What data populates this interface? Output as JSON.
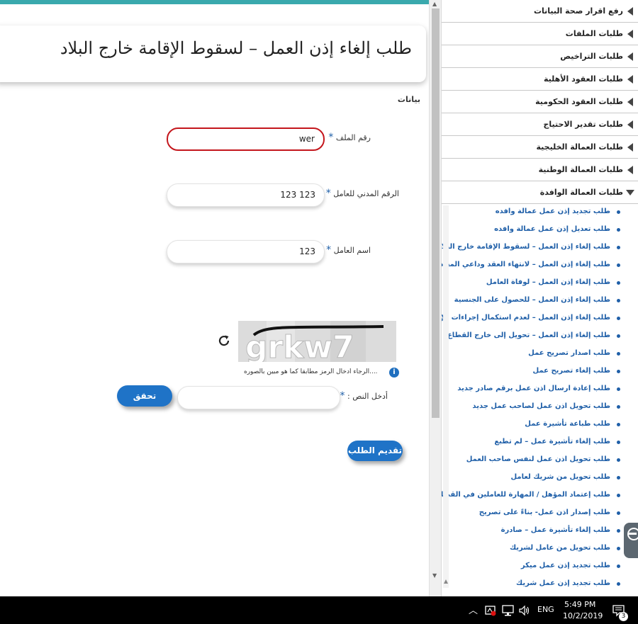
{
  "form": {
    "title": "طلب إلغاء إذن العمل – لسقوط الإقامة خارج البلاد",
    "section_label": "بيانات",
    "required_mark": "*",
    "file_number": {
      "label": "رقم الملف",
      "value": "wer"
    },
    "civil_id": {
      "label": "الرقم المدني للعامل",
      "value": "123 123"
    },
    "worker_name": {
      "label": "اسم العامل",
      "value": "123"
    },
    "captcha": {
      "image_text": "grkw7",
      "hint": "....الرجاء ادخال الرمز مطابقا كما هو مبين بالصوره",
      "info_icon": "i",
      "input_label": "أدخل النص :",
      "input_value": "",
      "verify_button": "تحقق"
    },
    "submit_button": "تقديم الطلب"
  },
  "sidebar": {
    "categories": [
      {
        "label": "رفع اقرار صحة البيانات",
        "expanded": false
      },
      {
        "label": "طلبات الملفات",
        "expanded": false
      },
      {
        "label": "طلبات التراخيص",
        "expanded": false
      },
      {
        "label": "طلبات العقود الأهلية",
        "expanded": false
      },
      {
        "label": "طلبات العقود الحكومية",
        "expanded": false
      },
      {
        "label": "طلبات تقدير الاحتياج",
        "expanded": false
      },
      {
        "label": "طلبات العمالة الخليجية",
        "expanded": false
      },
      {
        "label": "طلبات العمالة الوطنية",
        "expanded": false
      },
      {
        "label": "طلبات العمالة الوافدة",
        "expanded": true
      }
    ],
    "sub_items": [
      "طلب تجديد إذن عمل عمالة وافده",
      "طلب تعديل إذن عمل عمالة وافده",
      "طلب إلغاء إذن العمل – لسقوط الإقامة خارج البلاد",
      "طلب إلغاء إذن العمل – لانتهاء العقد وداعي المغادرة",
      "طلب إلغاء إذن العمل – لوفاة العامل",
      "طلب إلغاء إذن العمل – للحصول على الجنسية",
      "طلب إلغاء إذن العمل – لعدم استكمال إجراءات الإقامة",
      "طلب إلغاء إذن العمل – تحويل إلى خارج القطاع",
      "طلب اصدار تصريح عمل",
      "طلب إلغاء تصريح عمل",
      "طلب إعادة ارسال اذن عمل برقم صادر جديد",
      "طلب تحويل اذن عمل لصاحب عمل جديد",
      "طلب طباعة تأشيرة عمل",
      "طلب إلغاء تأشيرة عمل – لم تطبع",
      "طلب تحويل اذن عمل لنفس صاحب العمل",
      "طلب تحويل من شريك لعامل",
      "طلب إعتماد المؤهل / المهارة للعاملين في القطاع",
      "طلب إصدار اذن عمل- بناءً على تصريح",
      "طلب إلغاء تأشيرة عمل – صادرة",
      "طلب تحويل من عامل لشريك",
      "طلب تجديد إذن عمل ميكر",
      "طلب تجديد إذن عمل شريك"
    ]
  },
  "taskbar": {
    "language": "ENG",
    "time": "5:49 PM",
    "date": "10/2/2019",
    "notification_count": "3",
    "icons": [
      "chevron-up-icon",
      "network-alert-icon",
      "monitor-icon",
      "volume-icon",
      "notification-icon"
    ]
  },
  "colors": {
    "accent_teal": "#3aa9ad",
    "link_blue": "#1f5fa8",
    "button_blue": "#1f73c7",
    "error_red": "#c4161c"
  }
}
